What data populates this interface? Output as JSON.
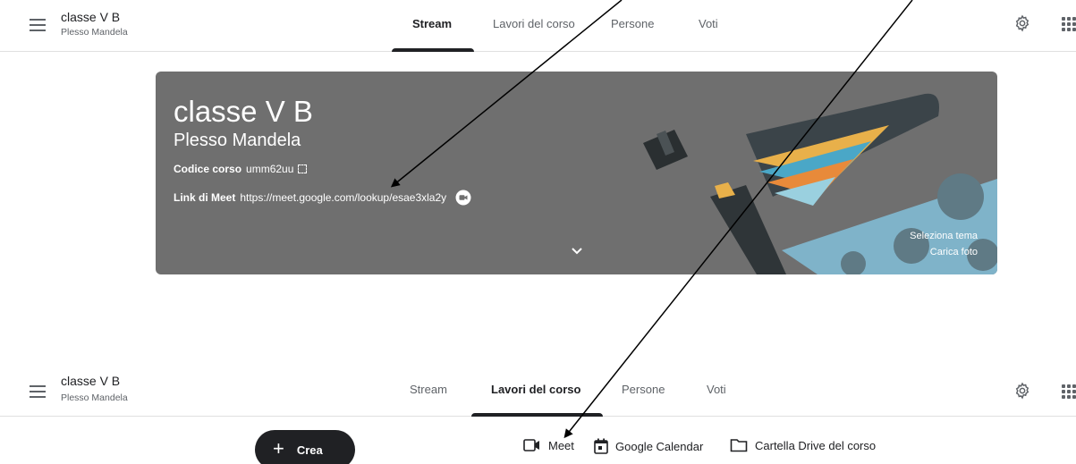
{
  "header_top": {
    "class_name": "classe V B",
    "class_section": "Plesso Mandela",
    "tabs": [
      {
        "label": "Stream",
        "active": true
      },
      {
        "label": "Lavori del corso",
        "active": false
      },
      {
        "label": "Persone",
        "active": false
      },
      {
        "label": "Voti",
        "active": false
      }
    ]
  },
  "banner": {
    "title": "classe V B",
    "subtitle": "Plesso Mandela",
    "code_label": "Codice corso",
    "code_value": "umm62uu",
    "meet_label": "Link di Meet",
    "meet_url": "https://meet.google.com/lookup/esae3xla2y",
    "select_theme": "Seleziona tema",
    "upload_photo": "Carica foto",
    "background_color": "#6f6f6f"
  },
  "header_bottom": {
    "class_name": "classe V B",
    "class_section": "Plesso Mandela",
    "tabs": [
      {
        "label": "Stream",
        "active": false
      },
      {
        "label": "Lavori del corso",
        "active": true
      },
      {
        "label": "Persone",
        "active": false
      },
      {
        "label": "Voti",
        "active": false
      }
    ]
  },
  "toolbar": {
    "create_label": "Crea",
    "meet_label": "Meet",
    "calendar_label": "Google Calendar",
    "drive_label": "Cartella Drive del corso"
  },
  "icons": {
    "menu": "menu-icon",
    "settings": "gear-icon",
    "apps": "apps-grid-icon",
    "copy_code": "expand-icon",
    "meet": "video-camera-icon",
    "calendar": "calendar-icon",
    "folder": "folder-icon",
    "chevron": "chevron-down-icon"
  },
  "colors": {
    "accent_dark": "#202124",
    "text_secondary": "#5f6368",
    "divider": "#e0e0e0"
  }
}
